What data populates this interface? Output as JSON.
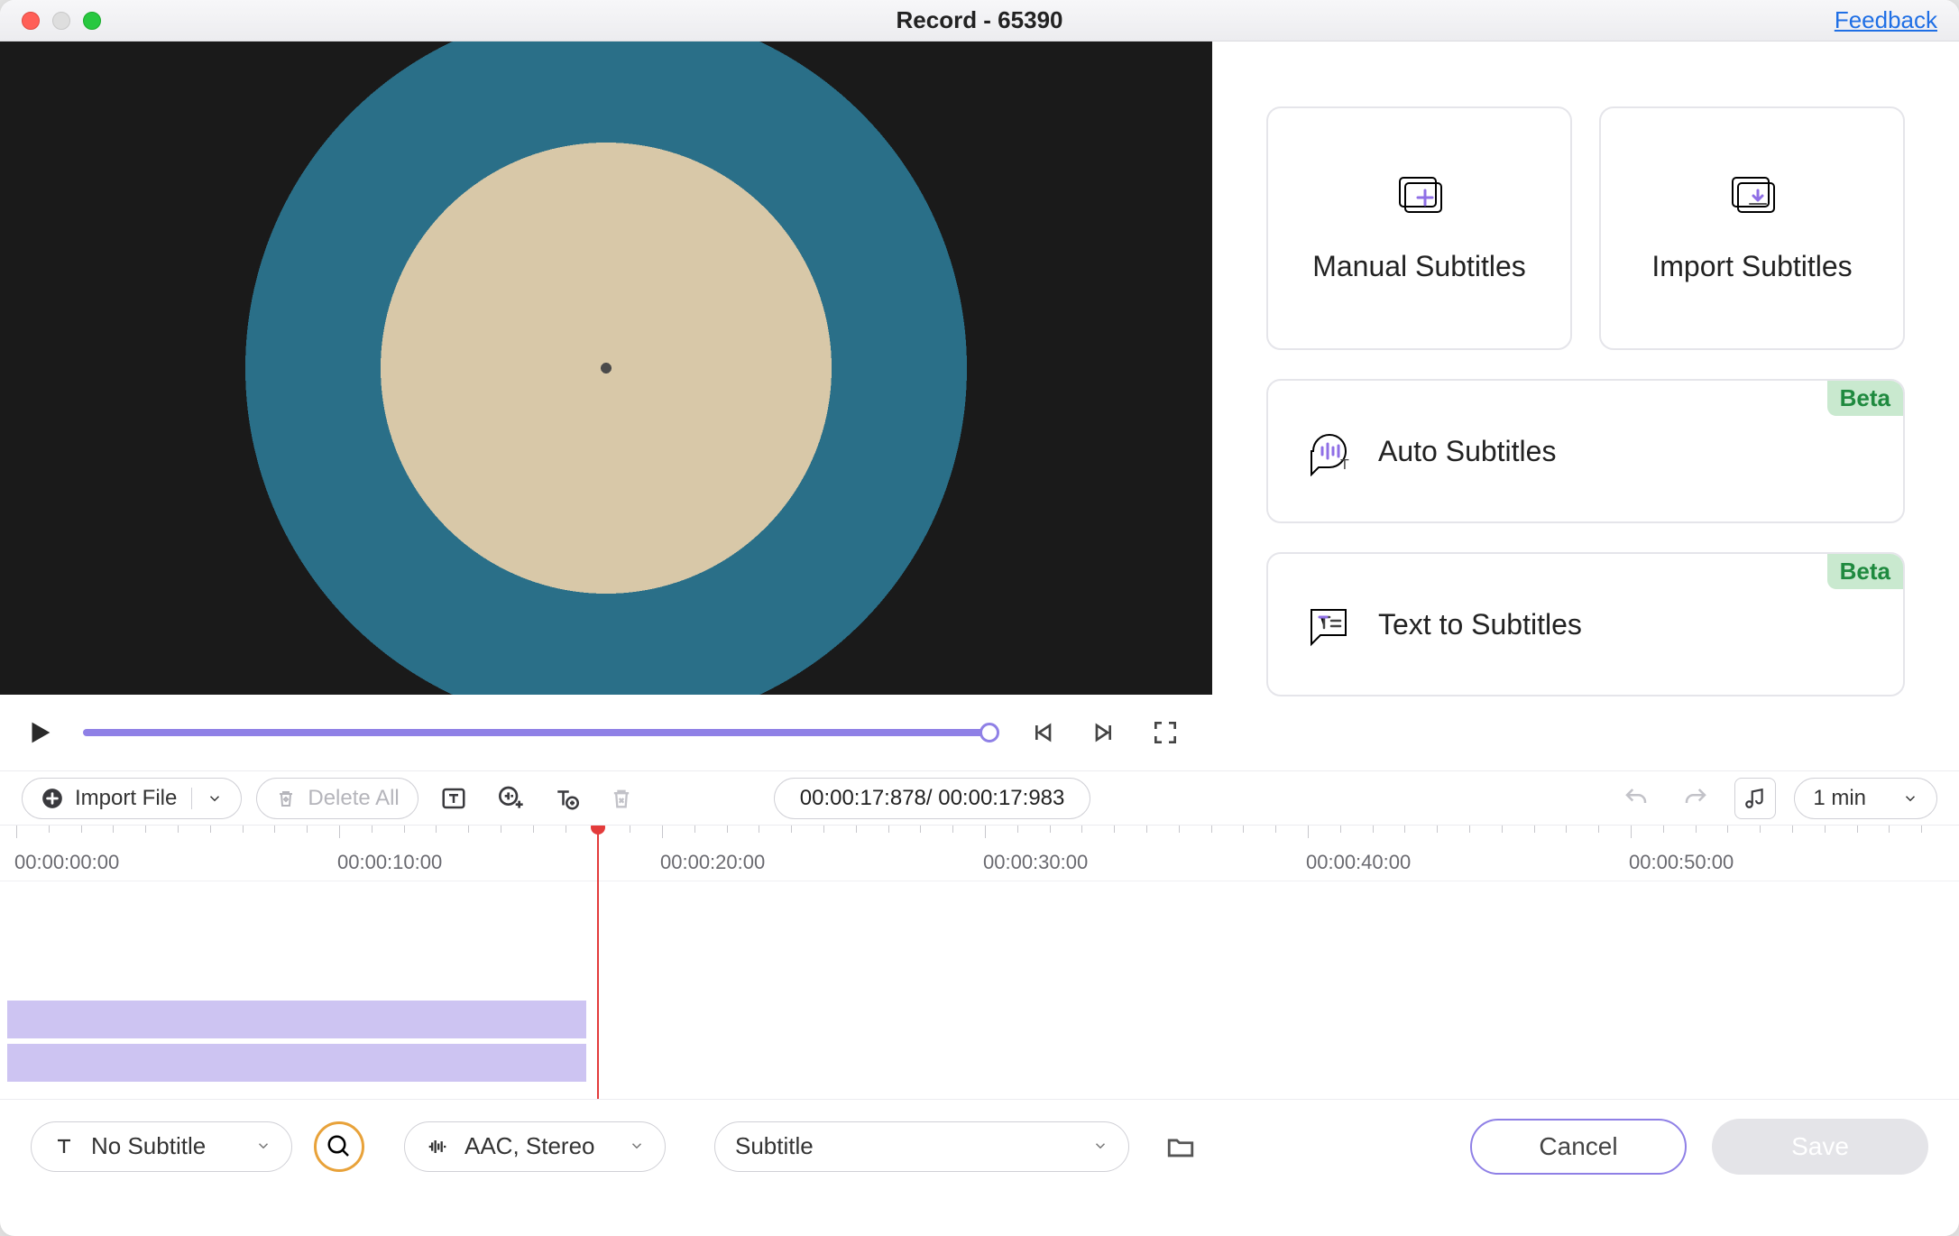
{
  "window": {
    "title": "Record - 65390",
    "feedback": "Feedback"
  },
  "options": {
    "manual": "Manual Subtitles",
    "import": "Import Subtitles",
    "auto": "Auto Subtitles",
    "text": "Text to Subtitles",
    "beta": "Beta"
  },
  "toolbar": {
    "import_file": "Import File",
    "delete_all": "Delete All",
    "current_time": "00:00:17:878",
    "total_time": "00:00:17:983",
    "zoom": "1 min"
  },
  "timeline": {
    "rulers": [
      "00:00:00:00",
      "00:00:10:00",
      "00:00:20:00",
      "00:00:30:00",
      "00:00:40:00",
      "00:00:50:00"
    ],
    "playhead_percent": 30.0
  },
  "bottom": {
    "subtitle_select": "No Subtitle",
    "audio_info": "AAC, Stereo",
    "category": "Subtitle",
    "cancel": "Cancel",
    "save": "Save"
  }
}
